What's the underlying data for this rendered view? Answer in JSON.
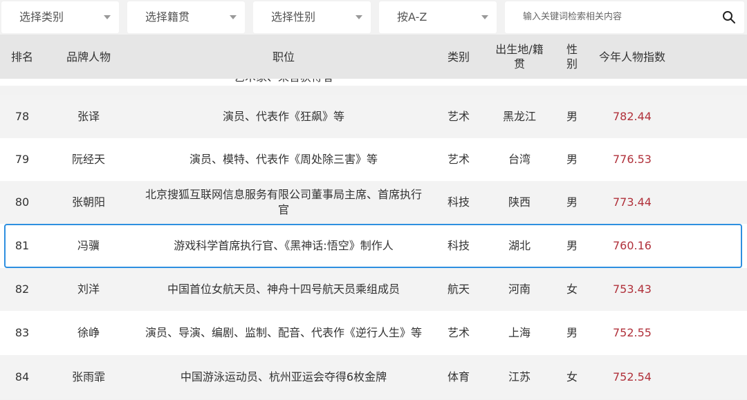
{
  "filters": {
    "category": "选择类别",
    "origin": "选择籍贯",
    "gender": "选择性别",
    "sort": "按A-Z",
    "search_placeholder": "输入关键词检索相关内容"
  },
  "table": {
    "headers": {
      "rank": "排名",
      "person": "品牌人物",
      "position": "职位",
      "category": "类别",
      "origin": "出生地/籍贯",
      "gender": "性别",
      "index": "今年人物指数"
    },
    "partial_prev_position": "艺术家、来言获得者",
    "rows": [
      {
        "rank": "78",
        "name": "张译",
        "position": "演员、代表作《狂飙》等",
        "category": "艺术",
        "origin": "黑龙江",
        "gender": "男",
        "index": "782.44"
      },
      {
        "rank": "79",
        "name": "阮经天",
        "position": "演员、模特、代表作《周处除三害》等",
        "category": "艺术",
        "origin": "台湾",
        "gender": "男",
        "index": "776.53"
      },
      {
        "rank": "80",
        "name": "张朝阳",
        "position": "北京搜狐互联网信息服务有限公司董事局主席、首席执行官",
        "category": "科技",
        "origin": "陕西",
        "gender": "男",
        "index": "773.44"
      },
      {
        "rank": "81",
        "name": "冯骥",
        "position": "游戏科学首席执行官、《黑神话:悟空》制作人",
        "category": "科技",
        "origin": "湖北",
        "gender": "男",
        "index": "760.16"
      },
      {
        "rank": "82",
        "name": "刘洋",
        "position": "中国首位女航天员、神舟十四号航天员乘组成员",
        "category": "航天",
        "origin": "河南",
        "gender": "女",
        "index": "753.43"
      },
      {
        "rank": "83",
        "name": "徐峥",
        "position": "演员、导演、编剧、监制、配音、代表作《逆行人生》等",
        "category": "艺术",
        "origin": "上海",
        "gender": "男",
        "index": "752.55"
      },
      {
        "rank": "84",
        "name": "张雨霏",
        "position": "中国游泳运动员、杭州亚运会夺得6枚金牌",
        "category": "体育",
        "origin": "江苏",
        "gender": "女",
        "index": "752.54"
      }
    ]
  },
  "colors": {
    "score": "#b0303a",
    "highlight_border": "#2d8fe0"
  }
}
